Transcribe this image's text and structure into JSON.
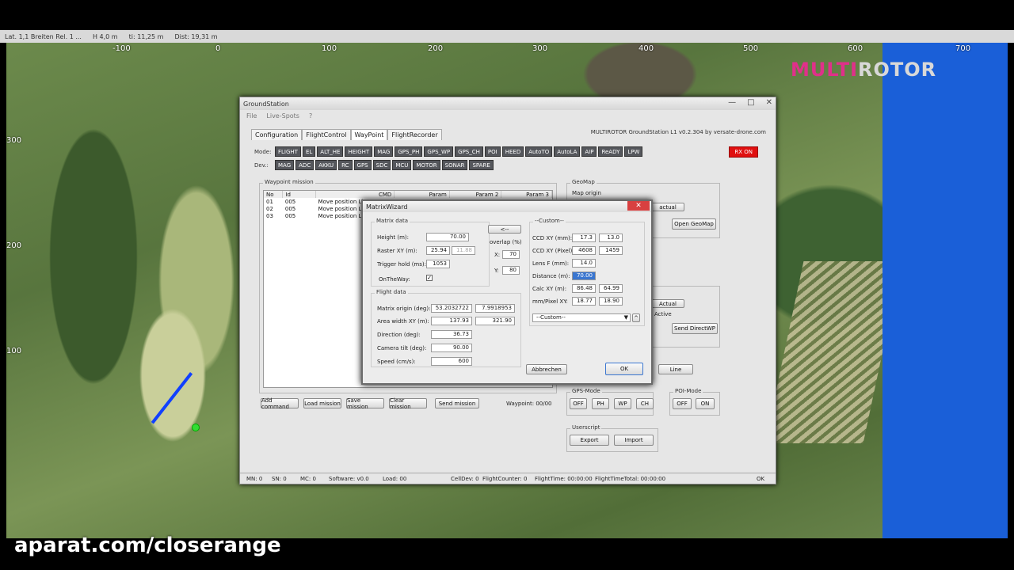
{
  "top_info": [
    "Lat. 1,1 Breiten Rel. 1 ...",
    "H 4,0 m",
    "ti: 11,25 m",
    "Dist: 19,31 m"
  ],
  "map": {
    "x_scale": [
      "-100",
      "0",
      "100",
      "200",
      "300",
      "400",
      "500",
      "600",
      "700"
    ],
    "y_scale": [
      "300",
      "200",
      "100"
    ],
    "logo_part1": "MULTI",
    "logo_part2": "ROTOR",
    "watermark": "aparat.com/closerange"
  },
  "window": {
    "title": "GroundStation",
    "menu": [
      "File",
      "Live-Spots",
      "?"
    ],
    "tabs": [
      "Configuration",
      "FlightControl",
      "WayPoint",
      "FlightRecorder"
    ],
    "version": "MULTIROTOR GroundStation L1 v0.2.304 by versate-drone.com",
    "mode_label": "Mode:",
    "dev_label": "Dev.:",
    "modes": [
      "FLIGHT",
      "EL",
      "ALT_HE",
      "HEIGHT",
      "MAG",
      "GPS_PH",
      "GPS_WP",
      "GPS_CH",
      "POI",
      "HEED",
      "AutoTO",
      "AutoLA",
      "AIP",
      "ReADY",
      "LPW"
    ],
    "devs": [
      "MAG",
      "ADC",
      "AKKU",
      "RC",
      "GPS",
      "SDC",
      "MCU",
      "MOTOR",
      "SONAR",
      "SPARE"
    ],
    "rf_button": "RX ON",
    "waypoint_group": "Waypoint mission",
    "wp_headers": [
      "No",
      "Id",
      "CMD",
      "Param",
      "Param 2",
      "Param 3"
    ],
    "wp_rows": [
      [
        "01",
        "005",
        "Move position Li"
      ],
      [
        "02",
        "005",
        "Move position Li"
      ],
      [
        "03",
        "005",
        "Move position Li"
      ]
    ],
    "buttons": {
      "add_command": "Add command",
      "load_mission": "Load mission",
      "save_mission": "Save mission",
      "clear_mission": "Clear mission",
      "send_mission": "Send mission",
      "open_geomap": "Open GeoMap",
      "send_directwp": "Send DirectWP",
      "line": "Line",
      "actual1": "actual",
      "actual2": "Actual",
      "export": "Export",
      "import": "Import"
    },
    "waypoint_counter": "Waypoint: 00/00",
    "geomap_group": "GeoMap",
    "map_origin": "Map origin",
    "active_label": "Active",
    "gps_mode_group": "GPS-Mode",
    "gps_mode_buttons": [
      "OFF",
      "PH",
      "WP",
      "CH"
    ],
    "poi_mode_group": "POI-Mode",
    "poi_mode_buttons": [
      "OFF",
      "ON"
    ],
    "userscript_group": "Userscript",
    "status": {
      "mn": "MN: 0",
      "sn": "SN: 0",
      "mc": "MC: 0",
      "software": "Software: v0.0",
      "load": "Load: 00",
      "celldev": "CellDev: 0",
      "flightcounter": "FlightCounter: 0",
      "flighttime": "FlightTime: 00:00:00",
      "flighttimetotal": "FlightTimeTotal: 00:00:00",
      "conn": "OK"
    }
  },
  "dialog": {
    "title": "MatrixWizard",
    "close": "✕",
    "matrix_group": "Matrix data",
    "height_label": "Height (m):",
    "height_value": "70.00",
    "raster_label": "Raster XY (m):",
    "raster_x": "25.94",
    "raster_y": "11.88",
    "trigger_label": "Trigger hold (ms):",
    "trigger_value": "1053",
    "ontheway_label": "OnTheWay:",
    "ontheway_check": "✓",
    "arrow_button": "<--",
    "overlap_label": "overlap (%)",
    "overlap_x_label": "X:",
    "overlap_x": "70",
    "overlap_y_label": "Y:",
    "overlap_y": "80",
    "flight_group": "Flight data",
    "origin_label": "Matrix origin (deg):",
    "origin_lat": "53.2032722",
    "origin_lon": "7.9918953",
    "area_label": "Area width XY (m):",
    "area_x": "137.93",
    "area_y": "321.90",
    "direction_label": "Direction (deg):",
    "direction_value": "36.73",
    "tilt_label": "Camera tilt (deg):",
    "tilt_value": "90.00",
    "speed_label": "Speed (cm/s):",
    "speed_value": "600",
    "custom_group": "--Custom--",
    "ccd_mm_label": "CCD XY (mm):",
    "ccd_mm_x": "17.3",
    "ccd_mm_y": "13.0",
    "ccd_px_label": "CCD XY (Pixel):",
    "ccd_px_x": "4608",
    "ccd_px_y": "1459",
    "lens_label": "Lens F (mm):",
    "lens_value": "14.0",
    "distance_label": "Distance (m):",
    "distance_value": "70.00",
    "calc_label": "Calc XY (m):",
    "calc_x": "86.48",
    "calc_y": "64.99",
    "mmpx_label": "mm/Pixel XY:",
    "mmpx_x": "18.77",
    "mmpx_y": "18.90",
    "preset_select": "--Custom--",
    "cancel": "Abbrechen",
    "ok": "OK"
  }
}
